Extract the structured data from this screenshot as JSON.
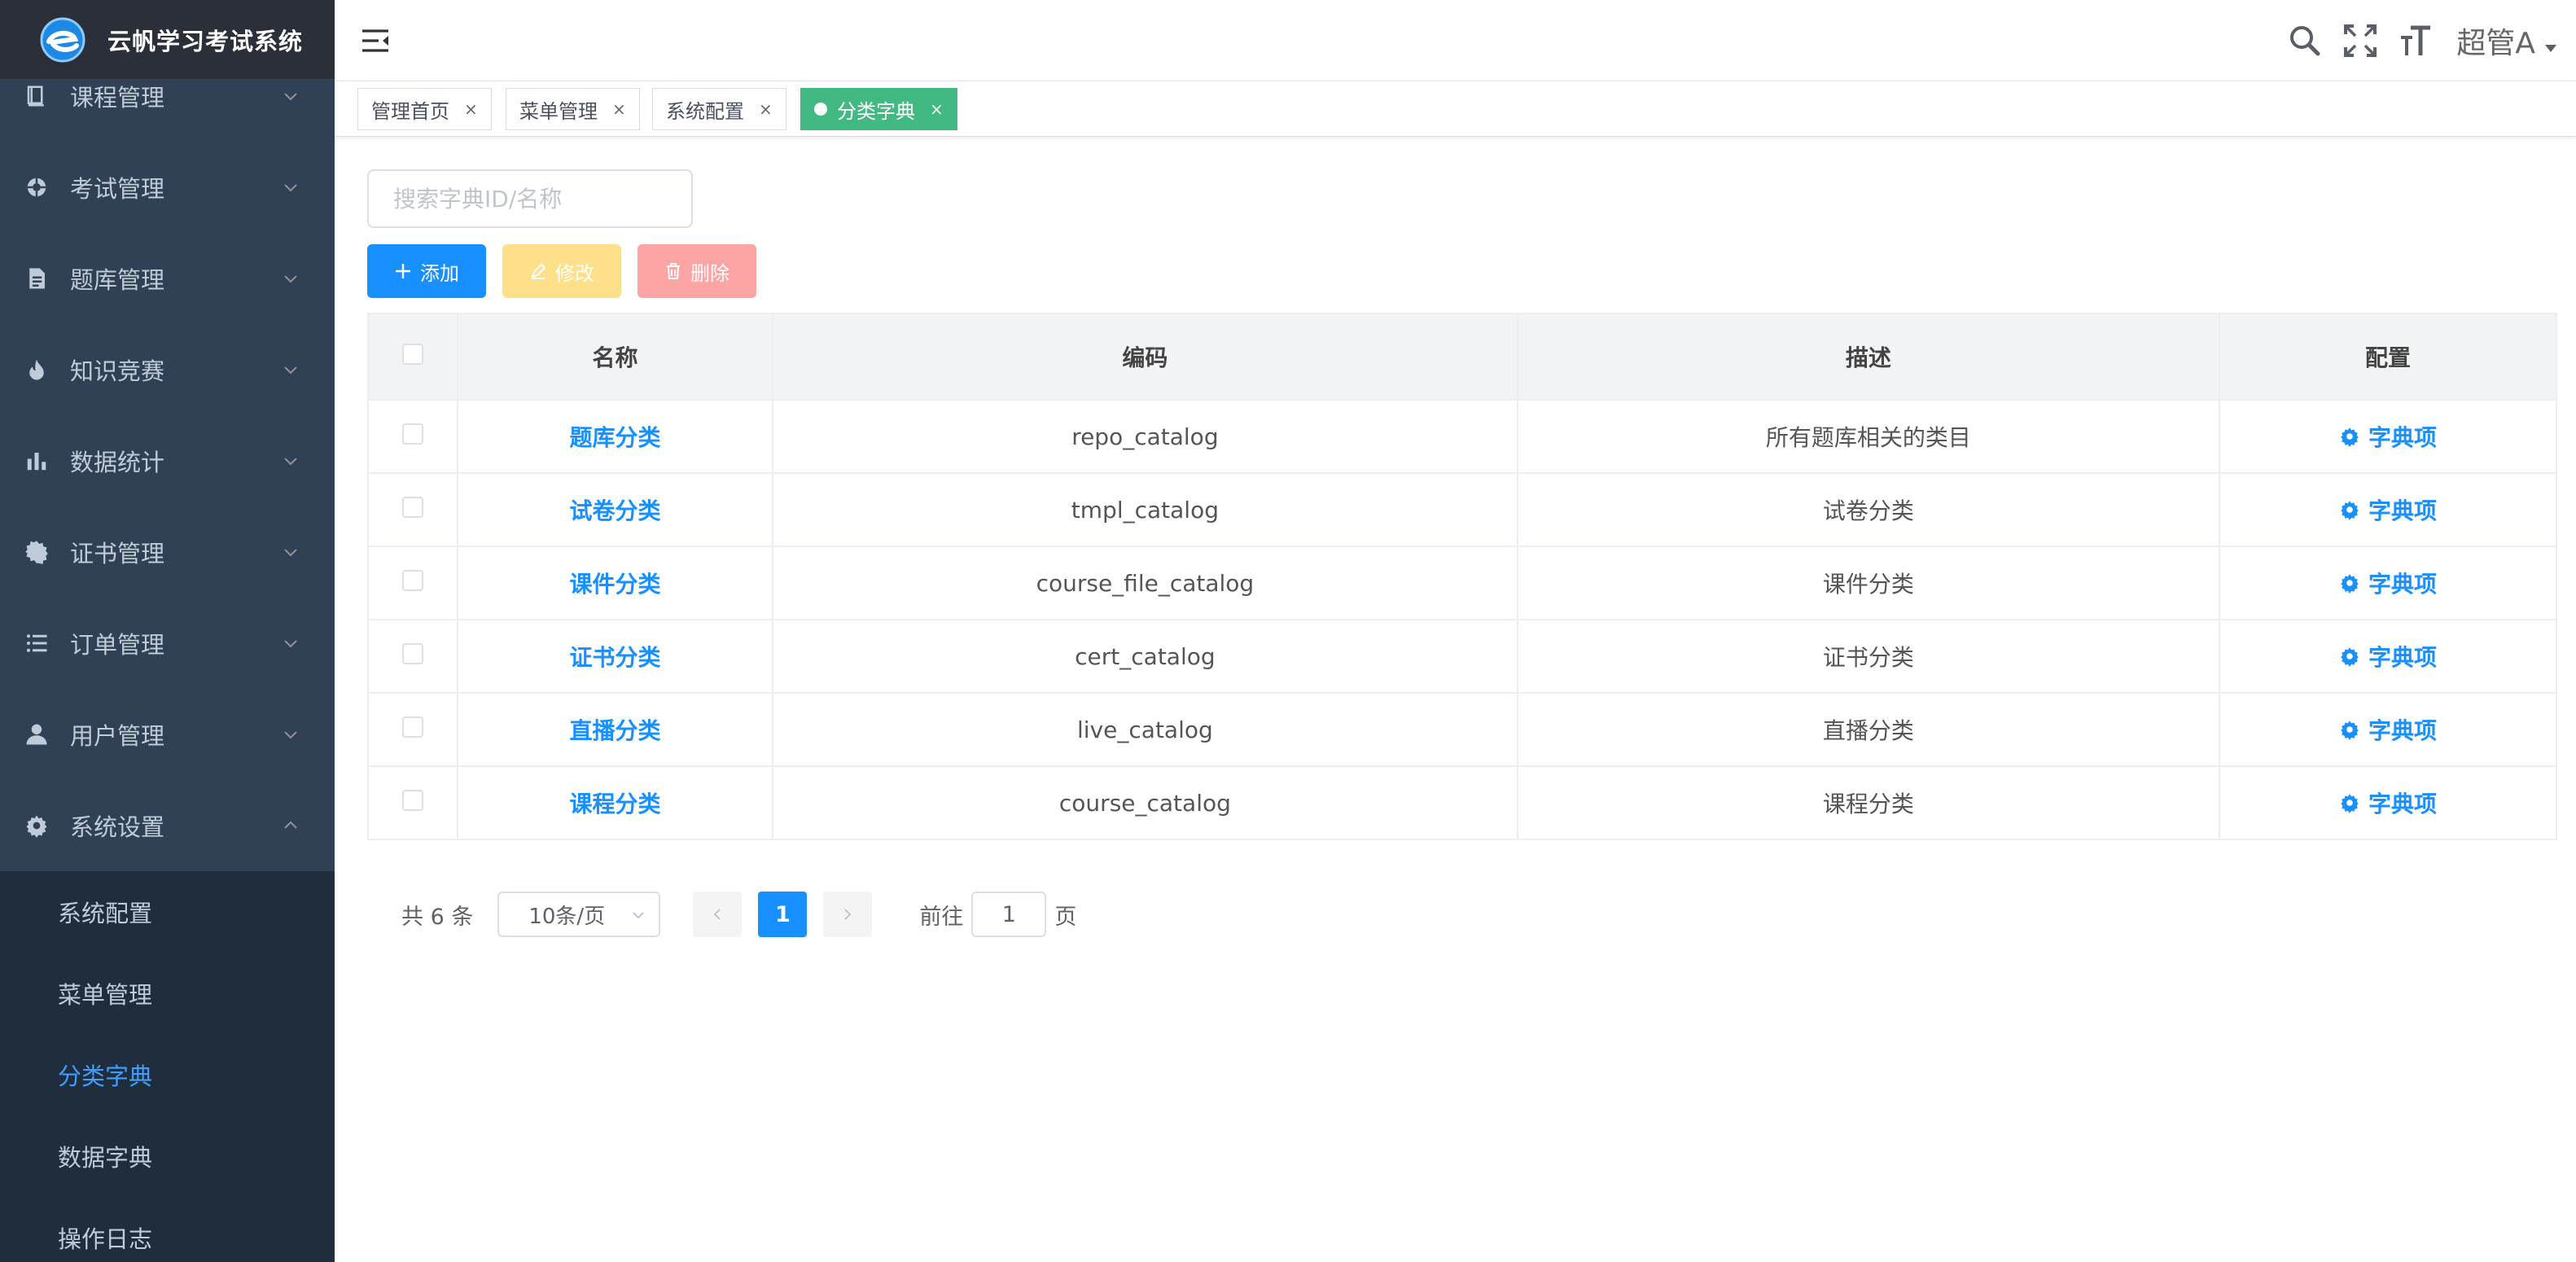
{
  "app": {
    "title": "云帆学习考试系统"
  },
  "colors": {
    "sidebar_bg": "#304156",
    "accent": "#1890ff",
    "active_tag": "#42b983"
  },
  "sidebar": {
    "items": [
      {
        "label": "课程管理",
        "icon": "book-icon"
      },
      {
        "label": "考试管理",
        "icon": "target-icon"
      },
      {
        "label": "题库管理",
        "icon": "document-icon"
      },
      {
        "label": "知识竞赛",
        "icon": "flame-icon"
      },
      {
        "label": "数据统计",
        "icon": "bar-chart-icon"
      },
      {
        "label": "证书管理",
        "icon": "badge-icon"
      },
      {
        "label": "订单管理",
        "icon": "list-icon"
      },
      {
        "label": "用户管理",
        "icon": "user-icon"
      },
      {
        "label": "系统设置",
        "icon": "gear-icon"
      }
    ],
    "sub_items": [
      {
        "label": "系统配置"
      },
      {
        "label": "菜单管理"
      },
      {
        "label": "分类字典"
      },
      {
        "label": "数据字典"
      },
      {
        "label": "操作日志"
      }
    ]
  },
  "header": {
    "user": "超管A"
  },
  "tags": [
    {
      "label": "管理首页",
      "close": "×"
    },
    {
      "label": "菜单管理",
      "close": "×"
    },
    {
      "label": "系统配置",
      "close": "×"
    },
    {
      "label": "分类字典",
      "close": "×"
    }
  ],
  "search": {
    "placeholder": "搜索字典ID/名称",
    "value": ""
  },
  "toolbar": {
    "add_label": "添加",
    "edit_label": "修改",
    "delete_label": "删除"
  },
  "table": {
    "headers": [
      "名称",
      "编码",
      "描述",
      "配置"
    ],
    "rows": [
      {
        "name": "题库分类",
        "code": "repo_catalog",
        "desc": "所有题库相关的类目",
        "action": "字典项"
      },
      {
        "name": "试卷分类",
        "code": "tmpl_catalog",
        "desc": "试卷分类",
        "action": "字典项"
      },
      {
        "name": "课件分类",
        "code": "course_file_catalog",
        "desc": "课件分类",
        "action": "字典项"
      },
      {
        "name": "证书分类",
        "code": "cert_catalog",
        "desc": "证书分类",
        "action": "字典项"
      },
      {
        "name": "直播分类",
        "code": "live_catalog",
        "desc": "直播分类",
        "action": "字典项"
      },
      {
        "name": "课程分类",
        "code": "course_catalog",
        "desc": "课程分类",
        "action": "字典项"
      }
    ]
  },
  "pagination": {
    "total": "共 6 条",
    "page_size": "10条/页",
    "current_page": "1",
    "goto_label": "前往",
    "goto_value": "1",
    "goto_suffix": "页"
  }
}
